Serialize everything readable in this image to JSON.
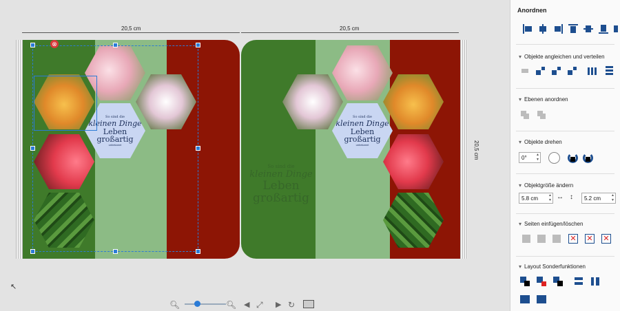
{
  "canvas": {
    "dim_top_left": "20,5 cm",
    "dim_top_right": "20,5 cm",
    "dim_right": "20,5 cm",
    "page_colors": {
      "dark_green": "#3f7a2a",
      "light_green": "#8cbb85",
      "red": "#8d1505"
    },
    "quote": {
      "line1": "So sind die",
      "line2": "kleinen Dinge",
      "line3": "Leben",
      "line4": "großartig",
      "line5": "unbekannt"
    }
  },
  "panel": {
    "title": "Anordnen",
    "sections": {
      "align": "Objekte angleichen und verteilen",
      "layers": "Ebenen anordnen",
      "rotate": "Objekte drehen",
      "size": "Objektgröße ändern",
      "pages": "Seiten einfügen/löschen",
      "layout": "Layout Sonderfunktionen"
    },
    "rotate_value": "0°",
    "width_value": "5.8 cm",
    "height_value": "5.2 cm"
  },
  "bottom": {
    "zoom_level": 0.3
  },
  "icons": [
    "zoom-out-icon",
    "zoom-in-icon",
    "fit-icon",
    "prev-page-icon",
    "next-page-icon",
    "rotate-view-icon",
    "keyboard-icon",
    "close-icon",
    "cursor-icon"
  ]
}
